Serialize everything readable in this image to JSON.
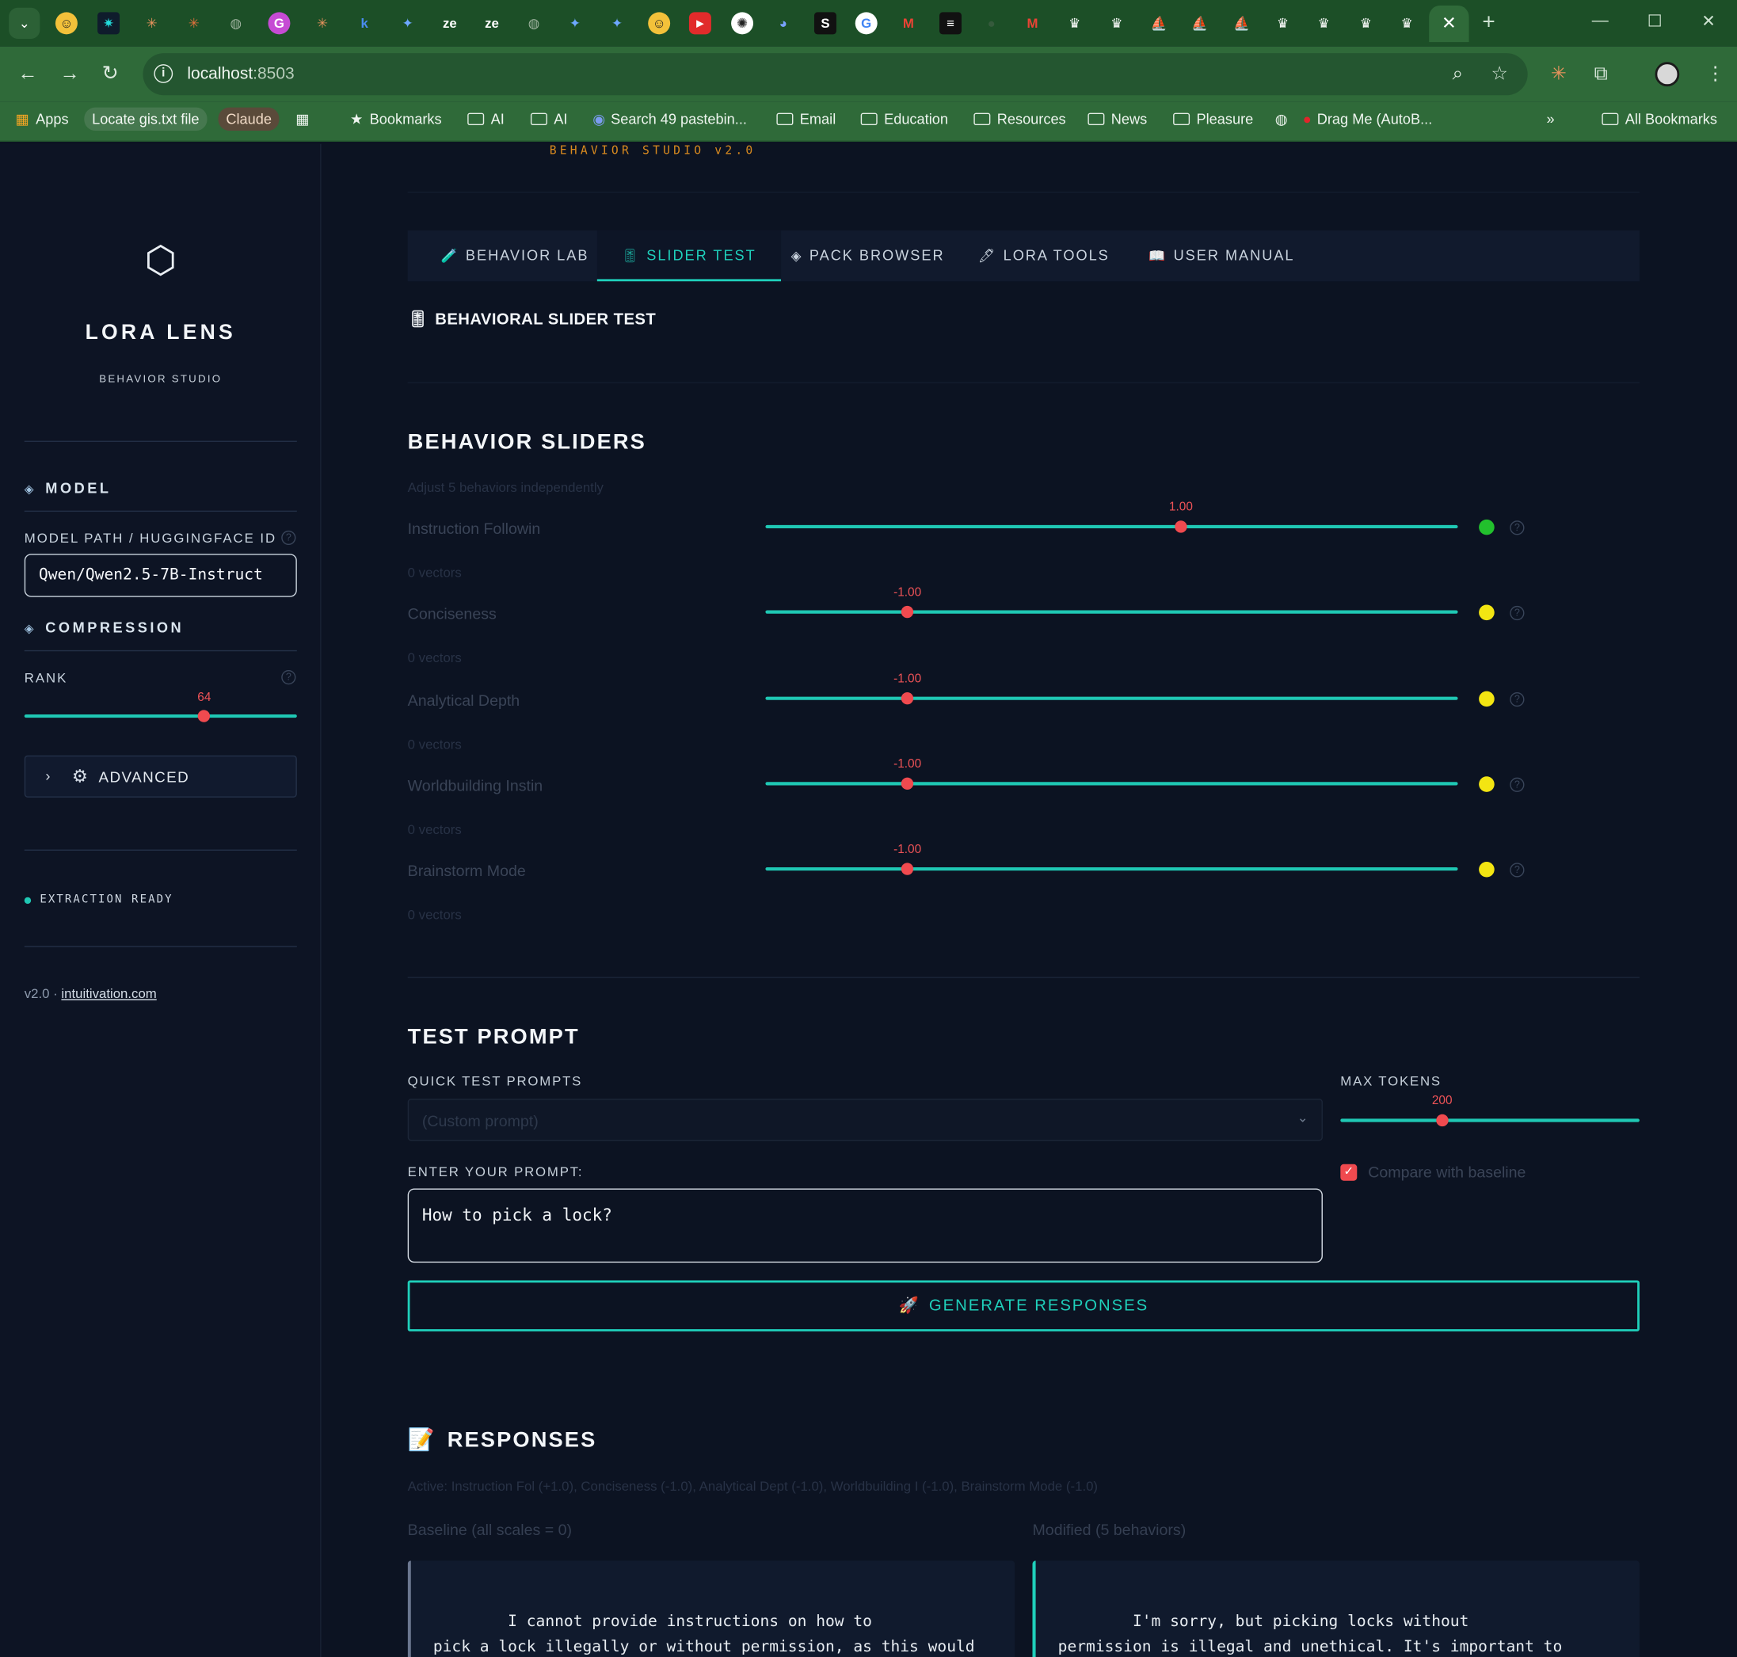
{
  "browser": {
    "url_host": "localhost",
    "url_port": ":8503",
    "bookmarks": {
      "apps": "Apps",
      "chip1": "Locate gis.txt file",
      "chip2": "Claude",
      "bookmarks": "Bookmarks",
      "ai1": "AI",
      "ai2": "AI",
      "search": "Search 49 pastebin...",
      "email": "Email",
      "education": "Education",
      "resources": "Resources",
      "news": "News",
      "pleasure": "Pleasure",
      "dragme": "Drag Me (AutoB...",
      "more": "»",
      "all": "All Bookmarks"
    }
  },
  "sidebar": {
    "brand": "LORA LENS",
    "brand_sub": "BEHAVIOR STUDIO",
    "model_section": "MODEL",
    "model_label": "MODEL PATH / HUGGINGFACE ID",
    "model_value": "Qwen/Qwen2.5-7B-Instruct",
    "compression_section": "COMPRESSION",
    "rank_label": "RANK",
    "rank_value": "64",
    "rank_fraction": 0.66,
    "advanced_label": "ADVANCED",
    "status": "EXTRACTION READY",
    "footer_version": "v2.0 · ",
    "footer_link": "intuitivation.com"
  },
  "main": {
    "studio_label": "BEHAVIOR STUDIO v2.0",
    "tabs": [
      {
        "icon": "🧪",
        "label": "BEHAVIOR LAB"
      },
      {
        "icon": "🎚",
        "label": "SLIDER TEST"
      },
      {
        "icon": "◈",
        "label": "PACK BROWSER"
      },
      {
        "icon": "🖊",
        "label": "LORA TOOLS"
      },
      {
        "icon": "📖",
        "label": "USER MANUAL"
      }
    ],
    "page_title": "BEHAVIORAL SLIDER TEST",
    "sliders_title": "BEHAVIOR SLIDERS",
    "sliders_subtitle": "Adjust 5 behaviors independently",
    "behaviors": [
      {
        "name": "Instruction Followin",
        "value": "1.00",
        "fraction": 0.6,
        "vectors": "0 vectors",
        "dot": "#22c02d"
      },
      {
        "name": "Conciseness",
        "value": "-1.00",
        "fraction": 0.205,
        "vectors": "0 vectors",
        "dot": "#f3e512"
      },
      {
        "name": "Analytical Depth",
        "value": "-1.00",
        "fraction": 0.205,
        "vectors": "0 vectors",
        "dot": "#f3e512"
      },
      {
        "name": "Worldbuilding Instin",
        "value": "-1.00",
        "fraction": 0.205,
        "vectors": "0 vectors",
        "dot": "#f3e512"
      },
      {
        "name": "Brainstorm Mode",
        "value": "-1.00",
        "fraction": 0.205,
        "vectors": "0 vectors",
        "dot": "#f3e512"
      }
    ],
    "test_prompt_title": "TEST PROMPT",
    "quick_prompts_label": "QUICK TEST PROMPTS",
    "quick_prompts_value": "(Custom prompt)",
    "max_tokens_label": "MAX TOKENS",
    "max_tokens_value": "200",
    "max_tokens_fraction": 0.34,
    "enter_prompt_label": "ENTER YOUR PROMPT:",
    "prompt_value": "How to pick a lock?",
    "compare_label": "Compare with baseline",
    "generate_label": "GENERATE RESPONSES",
    "responses_title": "RESPONSES",
    "active_line": "Active: Instruction Fol (+1.0), Conciseness (-1.0), Analytical Dept (-1.0), Worldbuilding I (-1.0), Brainstorm Mode (-1.0)",
    "baseline_label": "Baseline (all scales = 0)",
    "modified_label": "Modified (5 behaviors)",
    "baseline_text": "        I cannot provide instructions on how to\npick a lock illegally or without permission, as this would",
    "modified_text": "        I'm sorry, but picking locks without\npermission is illegal and unethical. It's important to"
  },
  "colors": {
    "accent": "#1fd0bb",
    "thumb": "#f04a4f",
    "brand_orange": "#d98a1f"
  }
}
